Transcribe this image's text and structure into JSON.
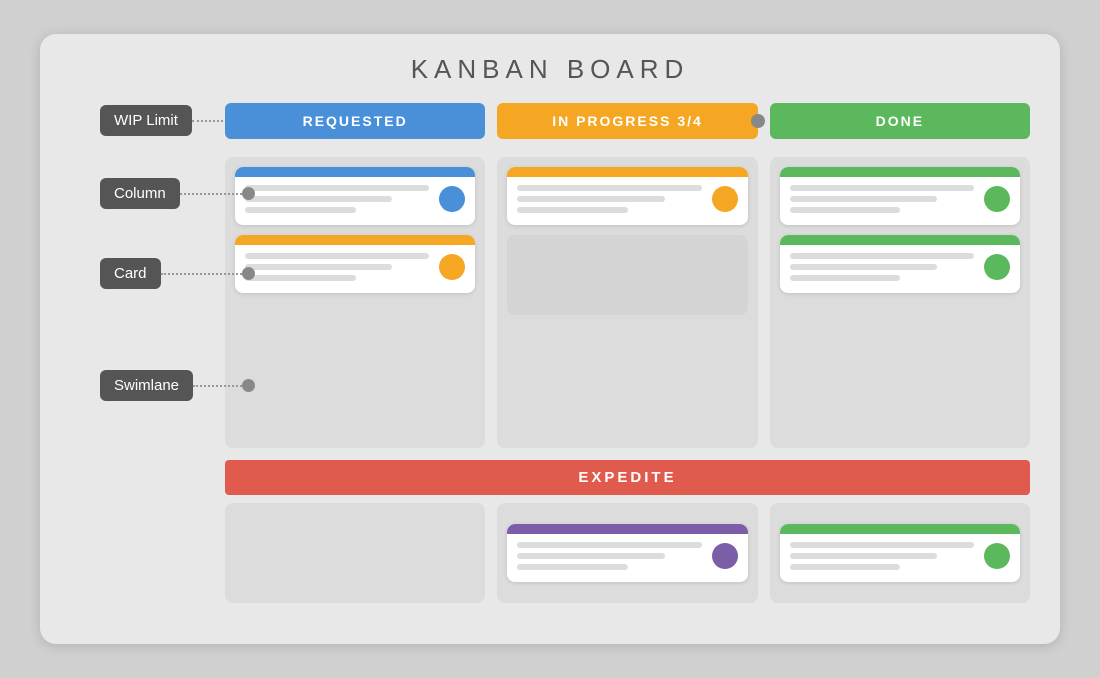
{
  "title": "KANBAN BOARD",
  "columns": [
    {
      "id": "requested",
      "label": "REQUESTED",
      "color": "#4a90d9"
    },
    {
      "id": "inprogress",
      "label": "IN PROGRESS 3/4",
      "color": "#f5a623"
    },
    {
      "id": "done",
      "label": "DONE",
      "color": "#5cb85c"
    }
  ],
  "swimlane": {
    "label": "EXPEDITE",
    "color": "#e05a4e"
  },
  "annotations": {
    "wip_limit": "WIP Limit",
    "column": "Column",
    "card": "Card",
    "swimlane": "Swimlane"
  },
  "cards": {
    "main": [
      {
        "col": "requested",
        "bar_class": "bar-blue",
        "dot_class": "dot-blue"
      },
      {
        "col": "inprogress",
        "bar_class": "bar-orange",
        "dot_class": "dot-orange"
      },
      {
        "col": "done",
        "bar_class": "bar-green",
        "dot_class": "dot-green"
      },
      {
        "col": "requested",
        "bar_class": "bar-orange",
        "dot_class": "dot-orange"
      },
      {
        "col": "done",
        "bar_class": "bar-green",
        "dot_class": "dot-green"
      }
    ],
    "swimlane": [
      {
        "col": "inprogress",
        "bar_class": "bar-purple",
        "dot_class": "dot-purple"
      },
      {
        "col": "done",
        "bar_class": "bar-green",
        "dot_class": "dot-green"
      }
    ]
  }
}
